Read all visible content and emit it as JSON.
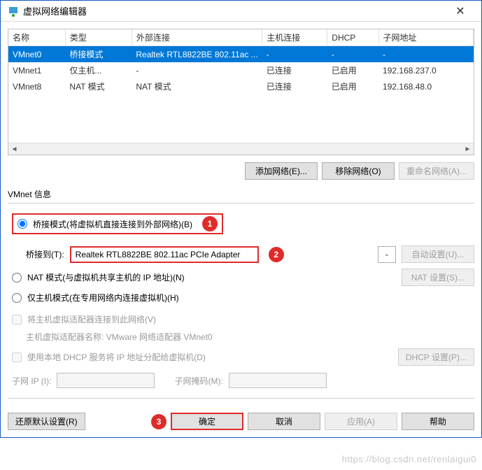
{
  "title": "虚拟网络编辑器",
  "table": {
    "headers": [
      "名称",
      "类型",
      "外部连接",
      "主机连接",
      "DHCP",
      "子网地址"
    ],
    "rows": [
      {
        "name": "VMnet0",
        "type": "桥接模式",
        "ext": "Realtek RTL8822BE 802.11ac ...",
        "host": "-",
        "dhcp": "-",
        "subnet": "-",
        "selected": true
      },
      {
        "name": "VMnet1",
        "type": "仅主机...",
        "ext": "-",
        "host": "已连接",
        "dhcp": "已启用",
        "subnet": "192.168.237.0"
      },
      {
        "name": "VMnet8",
        "type": "NAT 模式",
        "ext": "NAT 模式",
        "host": "已连接",
        "dhcp": "已启用",
        "subnet": "192.168.48.0"
      }
    ]
  },
  "buttons": {
    "add_net": "添加网络(E)...",
    "remove_net": "移除网络(O)",
    "rename_net": "重命名网络(A)...",
    "auto_set": "自动设置(U)...",
    "nat_set": "NAT 设置(S)...",
    "dhcp_set": "DHCP 设置(P)...",
    "restore": "还原默认设置(R)",
    "ok": "确定",
    "cancel": "取消",
    "apply": "应用(A)",
    "help": "帮助"
  },
  "section_label": "VMnet 信息",
  "radios": {
    "bridge": "桥接模式(将虚拟机直接连接到外部网络)(B)",
    "nat": "NAT 模式(与虚拟机共享主机的 IP 地址)(N)",
    "host": "仅主机模式(在专用网络内连接虚拟机)(H)"
  },
  "bridge_to_label": "桥接到(T):",
  "bridge_to_value": "Realtek RTL8822BE 802.11ac PCIe Adapter",
  "check_host_adapter": "将主机虚拟适配器连接到此网络(V)",
  "host_adapter_name": "主机虚拟适配器名称: VMware 网络适配器 VMnet0",
  "check_dhcp": "使用本地 DHCP 服务将 IP 地址分配给虚拟机(D)",
  "subnet_ip_label": "子网 IP (I):",
  "subnet_mask_label": "子网掩码(M):",
  "subnet_ip_value": "",
  "subnet_mask_value": "",
  "annotations": {
    "1": "1",
    "2": "2",
    "3": "3"
  },
  "watermark": "https://blog.csdn.net/renlaigui0"
}
